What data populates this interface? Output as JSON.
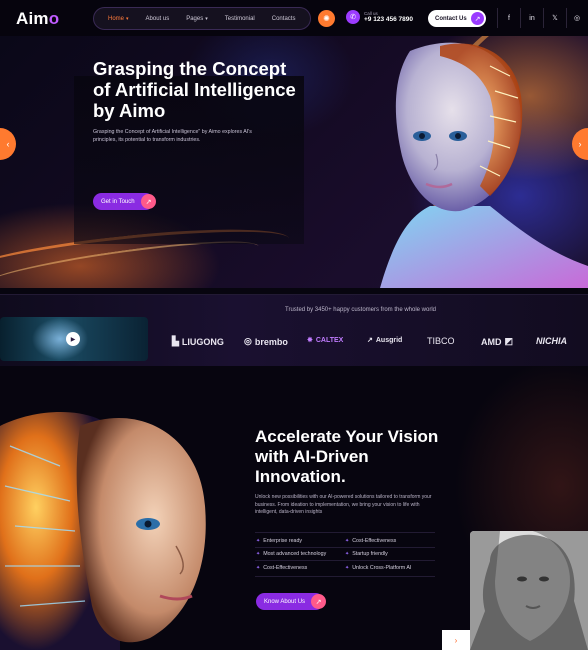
{
  "header": {
    "logo": "Aim",
    "logo_accent": "o",
    "nav": [
      {
        "label": "Home",
        "active": true,
        "caret": true
      },
      {
        "label": "About us",
        "active": false,
        "caret": false
      },
      {
        "label": "Pages",
        "active": false,
        "caret": true
      },
      {
        "label": "Testimonial",
        "active": false,
        "caret": false
      },
      {
        "label": "Contacts",
        "active": false,
        "caret": false
      }
    ],
    "call_label": "Call us",
    "phone": "+9 123 456 7890",
    "contact_button": "Contact Us",
    "social": [
      "facebook-icon",
      "linkedin-icon",
      "x-icon",
      "instagram-icon"
    ],
    "icons": {
      "orange": "sun-icon",
      "social_glyphs": [
        "f",
        "in",
        "𝕏",
        "◎"
      ]
    }
  },
  "hero": {
    "title": "Grasping the Concept of  Artificial Intelligence by Aimo",
    "description": "Grasping the Concept of Artificial Intelligence\" by Aimo explores AI's principles, its potential to transform industries.",
    "button": "Get in Touch",
    "prev_arrow": "‹",
    "next_arrow": "›"
  },
  "clients": {
    "trusted_text": "Trusted by 3450+ happy customers from the whole world",
    "logos": [
      "LIUGONG",
      "brembo",
      "CALTEX",
      "Ausgrid",
      "TIBCO",
      "AMD",
      "NICHIA"
    ]
  },
  "accelerate": {
    "title": "Accelerate Your Vision with AI-Driven Innovation.",
    "description": "Unlock new possibilities with our AI-powered solutions tailored to transform your business. From ideation to implementation, we bring your vision to life with intelligent, data-driven insights",
    "features_left": [
      "Enterprise ready",
      "Most advanced technology",
      "Cost-Effectiveness"
    ],
    "features_right": [
      "Cost-Effectiveness",
      "Startup friendly",
      "Unlock Cross-Platform AI"
    ],
    "button": "Know About Us",
    "corner_arrow": "›"
  },
  "colors": {
    "accent": "#8a2be2",
    "orange": "#ff7a2f",
    "pink": "#ff5a8a"
  }
}
